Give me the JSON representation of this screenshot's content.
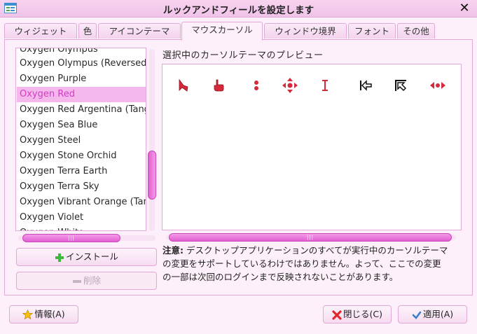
{
  "window": {
    "title": "ルックアンドフィールを設定します",
    "close_glyph": "✕"
  },
  "tabs": [
    {
      "label": "ウィジェット",
      "active": false
    },
    {
      "label": "色",
      "active": false
    },
    {
      "label": "アイコンテーマ",
      "active": false
    },
    {
      "label": "マウスカーソル",
      "active": true
    },
    {
      "label": "ウィンドウ境界",
      "active": false
    },
    {
      "label": "フォント",
      "active": false
    },
    {
      "label": "その他",
      "active": false
    }
  ],
  "cursor_themes": {
    "items": [
      {
        "label": "Oxygen Olympus",
        "selected": false
      },
      {
        "label": "Oxygen Olympus (Reversed)",
        "selected": false
      },
      {
        "label": "Oxygen Purple",
        "selected": false
      },
      {
        "label": "Oxygen Red",
        "selected": true
      },
      {
        "label": "Oxygen Red Argentina (Tango)",
        "selected": false
      },
      {
        "label": "Oxygen Sea Blue",
        "selected": false
      },
      {
        "label": "Oxygen Steel",
        "selected": false
      },
      {
        "label": "Oxygen Stone Orchid",
        "selected": false
      },
      {
        "label": "Oxygen Terra Earth",
        "selected": false
      },
      {
        "label": "Oxygen Terra Sky",
        "selected": false
      },
      {
        "label": "Oxygen Vibrant Orange (Tango)",
        "selected": false
      },
      {
        "label": "Oxygen Violet",
        "selected": false
      },
      {
        "label": "Oxygen White",
        "selected": false
      }
    ]
  },
  "buttons": {
    "install": "インストール",
    "remove": "削除",
    "about": "情報(A)",
    "close": "閉じる(C)",
    "apply": "適用(A)"
  },
  "preview": {
    "label": "選択中のカーソルテーマのプレビュー",
    "cursors": [
      "arrow-cursor-icon",
      "hand-cursor-icon",
      "busy-cursor-icon",
      "move-cursor-icon",
      "text-cursor-icon",
      "left-side-cursor-icon",
      "top-left-corner-cursor-icon",
      "horizontal-resize-cursor-icon"
    ]
  },
  "note": {
    "bold": "注意:",
    "text": " デスクトップアプリケーションのすべてが実行中のカーソルテーマの変更をサポートしているわけではありません。よって、ここでの変更の一部は次回のログインまで反映されないことがあります。"
  },
  "colors": {
    "accent": "#e25fd2",
    "selected_text": "#d23cc0",
    "cursor_red": "#d42a3c"
  }
}
